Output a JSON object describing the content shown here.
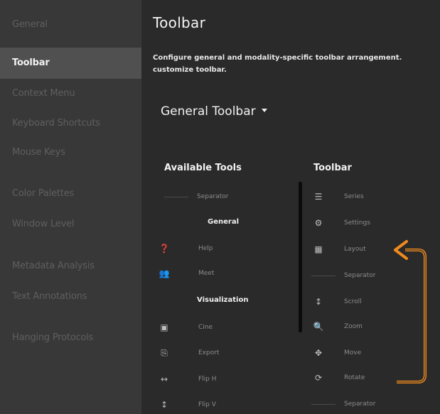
{
  "sidebar": {
    "items": [
      {
        "label": "General"
      },
      {
        "label": "Toolbar"
      },
      {
        "label": "Context Menu"
      },
      {
        "label": "Keyboard Shortcuts"
      },
      {
        "label": "Mouse Keys"
      },
      {
        "label": "Color Palettes"
      },
      {
        "label": "Window Level"
      },
      {
        "label": "Metadata Analysis"
      },
      {
        "label": "Text Annotations"
      },
      {
        "label": "Hanging Protocols"
      }
    ]
  },
  "main": {
    "title": "Toolbar",
    "description": "Configure general and modality-specific toolbar arrangement. customize toolbar.",
    "dropdown_label": "General Toolbar",
    "available": {
      "heading": "Available Tools",
      "separator_label": "Separator",
      "categories": [
        "General",
        "Visualization"
      ],
      "tools": [
        {
          "icon": "help-icon",
          "glyph": "❓",
          "label": "Help"
        },
        {
          "icon": "meet-icon",
          "glyph": "👥",
          "label": "Meet"
        },
        {
          "icon": "cine-icon",
          "glyph": "▣",
          "label": "Cine"
        },
        {
          "icon": "export-icon",
          "glyph": "⎘",
          "label": "Export"
        },
        {
          "icon": "flip-h-icon",
          "glyph": "↔",
          "label": "Flip H"
        },
        {
          "icon": "flip-v-icon",
          "glyph": "↕",
          "label": "Flip V"
        }
      ]
    },
    "toolbar": {
      "heading": "Toolbar",
      "items": [
        {
          "icon": "series-icon",
          "glyph": "☰",
          "label": "Series"
        },
        {
          "icon": "settings-icon",
          "glyph": "⚙",
          "label": "Settings"
        },
        {
          "icon": "layout-icon",
          "glyph": "▦",
          "label": "Layout"
        },
        {
          "icon": "separator",
          "glyph": "",
          "label": "Separator"
        },
        {
          "icon": "scroll-icon",
          "glyph": "↕",
          "label": "Scroll"
        },
        {
          "icon": "zoom-icon",
          "glyph": "🔍",
          "label": "Zoom"
        },
        {
          "icon": "move-icon",
          "glyph": "✥",
          "label": "Move"
        },
        {
          "icon": "rotate-icon",
          "glyph": "⟳",
          "label": "Rotate"
        },
        {
          "icon": "separator",
          "glyph": "",
          "label": "Separator"
        }
      ]
    }
  },
  "colors": {
    "annotation_arrow": "#f08a1e",
    "sidebar_bg": "#383838",
    "active_bg": "#505050"
  }
}
